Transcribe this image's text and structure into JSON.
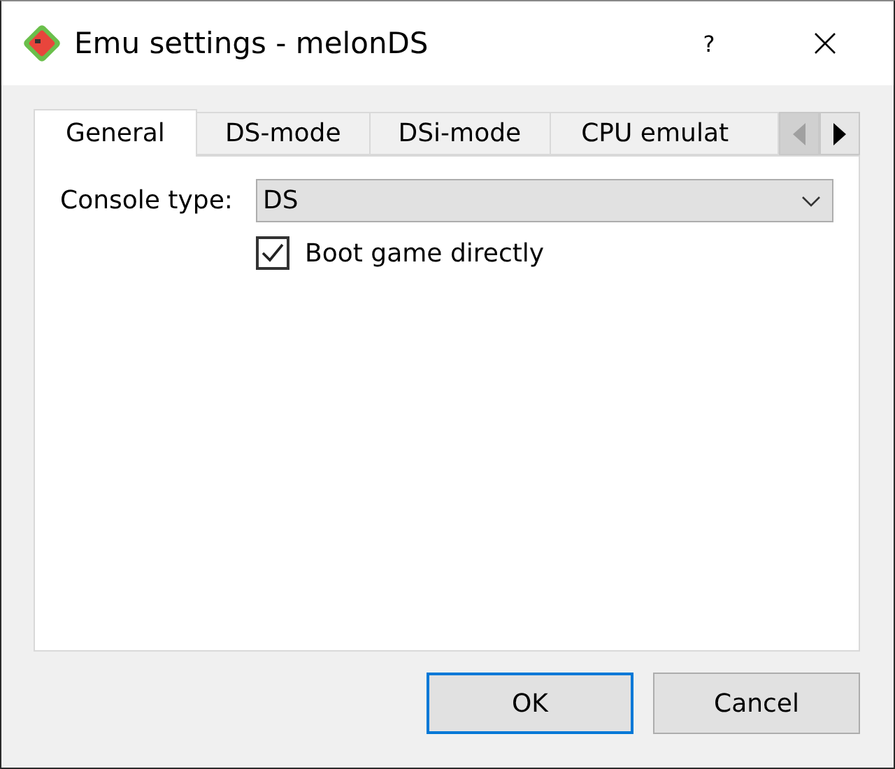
{
  "window": {
    "title": "Emu settings - melonDS",
    "help": "?"
  },
  "tabs": [
    {
      "label": "General",
      "selected": true
    },
    {
      "label": "DS-mode",
      "selected": false
    },
    {
      "label": "DSi-mode",
      "selected": false
    },
    {
      "label": "CPU emulat",
      "selected": false
    }
  ],
  "tab_scroll": [
    {
      "kind": "left",
      "disabled": true
    },
    {
      "kind": "right",
      "disabled": false
    }
  ],
  "console_type": {
    "label": "Console type:",
    "value": "DS"
  },
  "boot_direct": {
    "label": "Boot game directly",
    "checked": true
  },
  "buttons": [
    {
      "label": "OK",
      "default": true
    },
    {
      "label": "Cancel",
      "default": false
    }
  ]
}
